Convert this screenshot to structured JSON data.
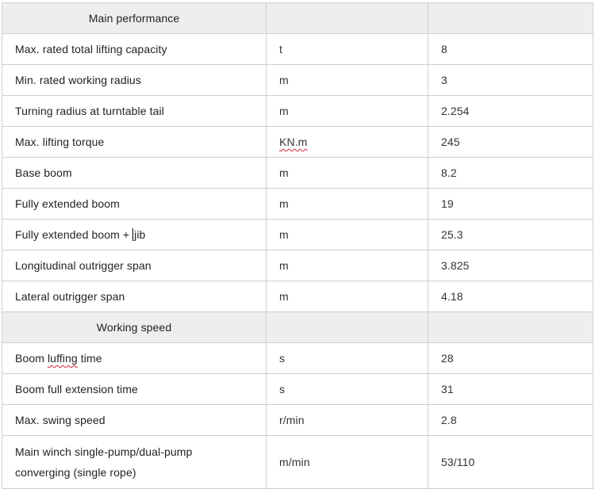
{
  "sections": [
    {
      "title": "Main performance",
      "rows": [
        {
          "name": "Max. rated total lifting capacity",
          "unit": "t",
          "value": "8"
        },
        {
          "name": "Min. rated working radius",
          "unit": "m",
          "value": "3"
        },
        {
          "name": "Turning radius at turntable tail",
          "unit": "m",
          "value": "2.254"
        },
        {
          "name": "Max. lifting torque",
          "unit": "KN.m",
          "value": "245"
        },
        {
          "name": "Base boom",
          "unit": "m",
          "value": "8.2"
        },
        {
          "name": "Fully extended boom",
          "unit": "m",
          "value": "19"
        },
        {
          "name_prefix": "Fully extended boom + ",
          "name_suffix": "jib",
          "unit": "m",
          "value": "25.3"
        },
        {
          "name": "Longitudinal outrigger span",
          "unit": "m",
          "value": "3.825"
        },
        {
          "name": "Lateral outrigger span",
          "unit": "m",
          "value": "4.18"
        }
      ]
    },
    {
      "title": "Working speed",
      "rows": [
        {
          "name_prefix": "Boom ",
          "name_squiggle": "luffing",
          "name_suffix": " time",
          "unit": "s",
          "value": "28"
        },
        {
          "name": "Boom full extension time",
          "unit": "s",
          "value": "31"
        },
        {
          "name": "Max. swing speed",
          "unit": "r/min",
          "value": "2.8"
        },
        {
          "name_line1": "Main winch single-pump/dual-pump",
          "name_line2": "converging (single rope)",
          "unit": "m/min",
          "value": "53/110"
        }
      ]
    }
  ]
}
